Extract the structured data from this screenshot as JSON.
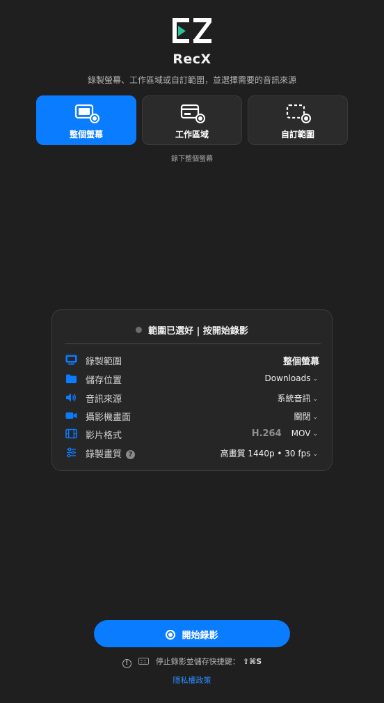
{
  "app": {
    "title": "RecX",
    "subtitle": "錄製螢幕、工作區域或自訂範圍，並選擇需要的音訊來源",
    "accent_color": "#0a7cff"
  },
  "modes": [
    {
      "label": "整個螢幕",
      "icon": "monitor-record-icon",
      "active": true
    },
    {
      "label": "工作區域",
      "icon": "window-record-icon",
      "active": false
    },
    {
      "label": "自訂範圍",
      "icon": "dashed-area-record-icon",
      "active": false
    }
  ],
  "mode_hint": "錄下整個螢幕",
  "panel": {
    "status": "範圍已選好 | 按開始錄影",
    "rows": {
      "range": {
        "label": "錄製範圍",
        "value": "整個螢幕",
        "icon": "screen-icon"
      },
      "location": {
        "label": "儲存位置",
        "value": "Downloads",
        "icon": "folder-icon"
      },
      "audio": {
        "label": "音訊來源",
        "value": "系統音訊",
        "icon": "speaker-icon"
      },
      "camera": {
        "label": "攝影機畫面",
        "value": "關閉",
        "icon": "camera-icon"
      },
      "format": {
        "label": "影片格式",
        "codec": "H.264",
        "value": "MOV",
        "icon": "film-icon"
      },
      "quality": {
        "label": "錄製畫質",
        "help": "?",
        "value": "高畫質 1440p • 30 fps",
        "icon": "sliders-icon"
      }
    }
  },
  "record_button": {
    "label": "開始錄影"
  },
  "footer": {
    "shortcut_text": "停止錄影並儲存快捷鍵：",
    "shortcut_keys": "⇧⌘S",
    "info_icon": "!",
    "privacy": "隱私權政策"
  }
}
